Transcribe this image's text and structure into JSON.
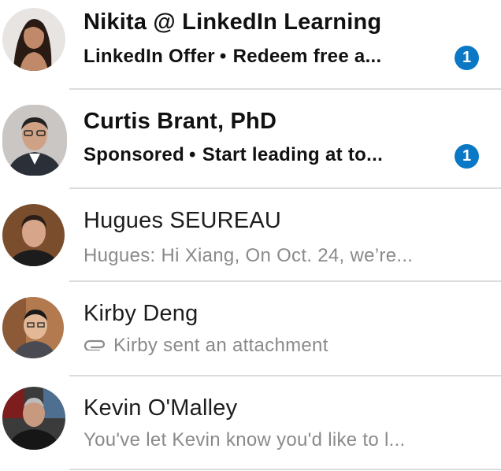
{
  "conversations": [
    {
      "name": "Nikita @ LinkedIn Learning",
      "label": "LinkedIn Offer",
      "separator": "•",
      "snippet": "Redeem free a...",
      "unread_count": "1",
      "avatar_icon": "person-avatar-nikita"
    },
    {
      "name": "Curtis Brant, PhD",
      "label": "Sponsored",
      "separator": "•",
      "snippet": "Start leading at to...",
      "unread_count": "1",
      "avatar_icon": "person-avatar-curtis"
    },
    {
      "name": "Hugues SEUREAU",
      "preview": "Hugues: Hi Xiang, On Oct. 24, we’re...",
      "avatar_icon": "person-avatar-hugues"
    },
    {
      "name": "Kirby Deng",
      "preview": "Kirby sent an attachment",
      "preview_icon": "paperclip-icon",
      "avatar_icon": "person-avatar-kirby"
    },
    {
      "name": "Kevin O'Malley",
      "preview": "You've let Kevin know you'd like to l...",
      "avatar_icon": "person-avatar-kevin"
    }
  ],
  "colors": {
    "badge": "#0a78c4",
    "divider": "#dcdcdc",
    "muted_text": "#8a8a8a",
    "primary_text": "#1d1d1d"
  }
}
